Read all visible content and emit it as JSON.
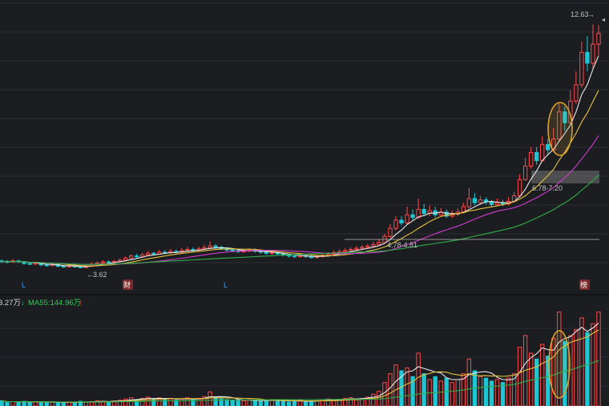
{
  "colors": {
    "background": "#1c1d21",
    "grid": "#2c2d33",
    "up": "#ff4a4a",
    "down": "#1fc7d4",
    "ma_white": "#e8e8e8",
    "ma_yellow": "#e5c33b",
    "ma_purple": "#d03cd0",
    "ma_green": "#2fae4a",
    "highlight_circle": "#e2a92e",
    "zone_fill": "#8a8a8a",
    "label_text": "#c0c0c0",
    "event_marker_bg": "#7a2a2a",
    "event_L": "#3aa0ff",
    "ma55_text": "#2fcf5a",
    "arrow_up": "#ff4a4a",
    "arrow_down": "#2fcf5a"
  },
  "price_chart": {
    "high_label": "12.63",
    "low_label": "3.62",
    "zone_label_upper": "6.78-7.20",
    "zone_label_lower": "4.78-4.81",
    "event_markers": [
      "L",
      "财",
      "L",
      "榜"
    ]
  },
  "volume_chart": {
    "ma_prev_value": "3.27万",
    "ma55_label": "MA55:144.96万"
  },
  "chart_data": {
    "type": "candlestick",
    "price_range": [
      3.3,
      13.0
    ],
    "candles": [
      [
        3.9,
        3.88,
        3.95,
        3.82
      ],
      [
        3.88,
        3.85,
        3.93,
        3.8
      ],
      [
        3.86,
        3.9,
        3.96,
        3.83
      ],
      [
        3.9,
        3.87,
        3.94,
        3.82
      ],
      [
        3.87,
        3.8,
        3.9,
        3.76
      ],
      [
        3.8,
        3.78,
        3.85,
        3.74
      ],
      [
        3.78,
        3.82,
        3.88,
        3.75
      ],
      [
        3.82,
        3.75,
        3.85,
        3.7
      ],
      [
        3.75,
        3.72,
        3.8,
        3.68
      ],
      [
        3.72,
        3.76,
        3.82,
        3.7
      ],
      [
        3.76,
        3.7,
        3.8,
        3.66
      ],
      [
        3.7,
        3.68,
        3.74,
        3.64
      ],
      [
        3.68,
        3.72,
        3.78,
        3.65
      ],
      [
        3.72,
        3.68,
        3.76,
        3.63
      ],
      [
        3.68,
        3.65,
        3.72,
        3.62
      ],
      [
        3.65,
        3.7,
        3.76,
        3.63
      ],
      [
        3.7,
        3.78,
        3.84,
        3.68
      ],
      [
        3.78,
        3.82,
        3.88,
        3.74
      ],
      [
        3.82,
        3.86,
        3.92,
        3.78
      ],
      [
        3.86,
        3.84,
        3.92,
        3.8
      ],
      [
        3.84,
        3.88,
        3.94,
        3.8
      ],
      [
        3.88,
        3.92,
        3.98,
        3.84
      ],
      [
        3.92,
        4.0,
        4.06,
        3.88
      ],
      [
        4.0,
        4.08,
        4.14,
        3.96
      ],
      [
        4.08,
        4.05,
        4.16,
        4.0
      ],
      [
        4.05,
        4.12,
        4.2,
        4.02
      ],
      [
        4.12,
        4.18,
        4.26,
        4.08
      ],
      [
        4.18,
        4.15,
        4.24,
        4.1
      ],
      [
        4.15,
        4.22,
        4.3,
        4.12
      ],
      [
        4.22,
        4.2,
        4.3,
        4.15
      ],
      [
        4.2,
        4.25,
        4.34,
        4.16
      ],
      [
        4.25,
        4.22,
        4.32,
        4.18
      ],
      [
        4.22,
        4.28,
        4.38,
        4.18
      ],
      [
        4.28,
        4.32,
        4.42,
        4.24
      ],
      [
        4.32,
        4.3,
        4.4,
        4.24
      ],
      [
        4.3,
        4.34,
        4.44,
        4.26
      ],
      [
        4.34,
        4.38,
        4.5,
        4.3
      ],
      [
        4.38,
        4.45,
        4.62,
        4.34
      ],
      [
        4.45,
        4.4,
        4.52,
        4.34
      ],
      [
        4.4,
        4.35,
        4.46,
        4.3
      ],
      [
        4.35,
        4.3,
        4.4,
        4.24
      ],
      [
        4.3,
        4.28,
        4.36,
        4.22
      ],
      [
        4.28,
        4.24,
        4.32,
        4.18
      ],
      [
        4.24,
        4.26,
        4.34,
        4.2
      ],
      [
        4.26,
        4.3,
        4.36,
        4.22
      ],
      [
        4.3,
        4.26,
        4.36,
        4.2
      ],
      [
        4.26,
        4.22,
        4.3,
        4.16
      ],
      [
        4.22,
        4.18,
        4.28,
        4.12
      ],
      [
        4.18,
        4.2,
        4.26,
        4.12
      ],
      [
        4.2,
        4.16,
        4.24,
        4.1
      ],
      [
        4.16,
        4.12,
        4.2,
        4.06
      ],
      [
        4.12,
        4.08,
        4.16,
        4.02
      ],
      [
        4.08,
        4.05,
        4.12,
        4.0
      ],
      [
        4.05,
        4.1,
        4.16,
        4.02
      ],
      [
        4.1,
        4.06,
        4.14,
        4.0
      ],
      [
        4.06,
        4.02,
        4.1,
        3.98
      ],
      [
        4.02,
        4.06,
        4.12,
        3.98
      ],
      [
        4.06,
        4.1,
        4.18,
        4.02
      ],
      [
        4.1,
        4.14,
        4.22,
        4.06
      ],
      [
        4.14,
        4.2,
        4.28,
        4.1
      ],
      [
        4.2,
        4.24,
        4.32,
        4.16
      ],
      [
        4.24,
        4.28,
        4.36,
        4.2
      ],
      [
        4.28,
        4.32,
        4.4,
        4.24
      ],
      [
        4.32,
        4.36,
        4.44,
        4.28
      ],
      [
        4.36,
        4.4,
        4.48,
        4.3
      ],
      [
        4.4,
        4.44,
        4.52,
        4.36
      ],
      [
        4.44,
        4.5,
        4.6,
        4.4
      ],
      [
        4.5,
        4.58,
        4.7,
        4.46
      ],
      [
        4.58,
        4.8,
        4.9,
        4.55
      ],
      [
        4.8,
        5.1,
        5.25,
        4.75
      ],
      [
        5.1,
        5.4,
        5.55,
        5.02
      ],
      [
        5.4,
        5.3,
        5.55,
        5.2
      ],
      [
        5.3,
        5.6,
        5.9,
        5.25
      ],
      [
        5.6,
        5.5,
        5.8,
        5.4
      ],
      [
        5.5,
        5.8,
        6.2,
        5.45
      ],
      [
        5.8,
        5.65,
        6.0,
        5.55
      ],
      [
        5.65,
        5.75,
        5.95,
        5.55
      ],
      [
        5.75,
        5.6,
        5.9,
        5.5
      ],
      [
        5.6,
        5.7,
        5.85,
        5.55
      ],
      [
        5.7,
        5.55,
        5.8,
        5.48
      ],
      [
        5.55,
        5.62,
        5.75,
        5.48
      ],
      [
        5.62,
        5.7,
        5.85,
        5.55
      ],
      [
        5.7,
        5.9,
        6.05,
        5.65
      ],
      [
        5.9,
        6.2,
        6.6,
        5.85
      ],
      [
        6.2,
        6.05,
        6.4,
        5.95
      ],
      [
        6.05,
        6.15,
        6.3,
        5.98
      ],
      [
        6.15,
        6.08,
        6.25,
        5.98
      ],
      [
        6.08,
        5.98,
        6.15,
        5.9
      ],
      [
        5.98,
        6.05,
        6.2,
        5.92
      ],
      [
        6.05,
        6.0,
        6.15,
        5.92
      ],
      [
        6.0,
        6.1,
        6.25,
        5.95
      ],
      [
        6.1,
        6.3,
        6.45,
        6.05
      ],
      [
        6.3,
        6.9,
        7.1,
        6.25
      ],
      [
        6.9,
        7.4,
        7.7,
        6.85
      ],
      [
        7.4,
        7.9,
        8.1,
        7.3
      ],
      [
        7.9,
        7.6,
        8.1,
        7.45
      ],
      [
        7.6,
        8.2,
        8.5,
        7.55
      ],
      [
        8.2,
        8.0,
        8.4,
        7.85
      ],
      [
        8.0,
        8.4,
        8.8,
        7.95
      ],
      [
        8.4,
        9.4,
        9.7,
        8.3
      ],
      [
        9.4,
        9.0,
        9.6,
        8.7
      ],
      [
        9.0,
        9.8,
        10.2,
        8.95
      ],
      [
        9.8,
        10.4,
        10.9,
        9.7
      ],
      [
        10.4,
        11.6,
        12.0,
        10.3
      ],
      [
        11.6,
        11.2,
        12.2,
        10.9
      ],
      [
        11.2,
        11.9,
        12.63,
        11.0
      ],
      [
        11.9,
        12.3,
        12.6,
        11.5
      ]
    ],
    "volumes": [
      18,
      12,
      15,
      14,
      16,
      12,
      15,
      13,
      12,
      14,
      13,
      11,
      14,
      12,
      16,
      14,
      15,
      18,
      16,
      14,
      17,
      20,
      24,
      28,
      22,
      26,
      30,
      24,
      28,
      22,
      26,
      20,
      24,
      28,
      22,
      26,
      32,
      48,
      30,
      24,
      22,
      18,
      20,
      18,
      22,
      18,
      16,
      20,
      22,
      18,
      16,
      14,
      18,
      20,
      16,
      14,
      18,
      22,
      24,
      20,
      22,
      26,
      28,
      24,
      26,
      30,
      40,
      50,
      80,
      110,
      140,
      120,
      130,
      100,
      180,
      110,
      90,
      100,
      85,
      95,
      80,
      90,
      110,
      160,
      120,
      100,
      95,
      85,
      90,
      80,
      95,
      110,
      200,
      240,
      180,
      160,
      210,
      170,
      230,
      320,
      220,
      240,
      260,
      300,
      250,
      280,
      320
    ],
    "volume_range": [
      0,
      330
    ]
  }
}
